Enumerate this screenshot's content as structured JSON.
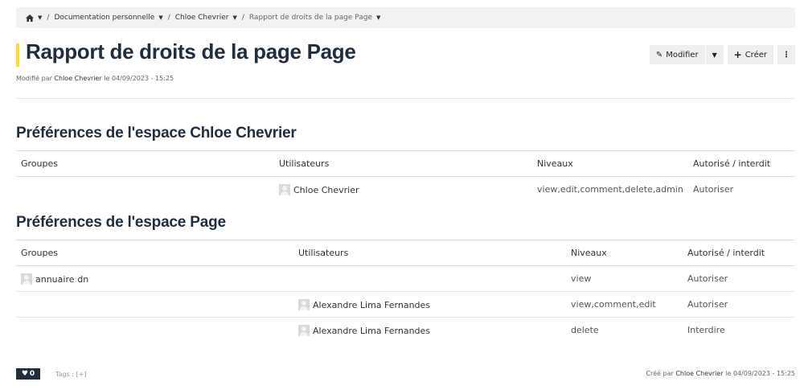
{
  "breadcrumb": {
    "items": [
      "Documentation personnelle",
      "Chloe Chevrier"
    ],
    "current": "Rapport de droits de la page Page"
  },
  "page": {
    "title": "Rapport de droits de la page Page",
    "modified_prefix": "Modifié par",
    "modified_user": "Chloe Chevrier",
    "modified_suffix": "le 04/09/2023 - 15:25"
  },
  "actions": {
    "edit_label": "Modifier",
    "create_label": "Créer"
  },
  "sections": [
    {
      "title": "Préférences de l'espace Chloe Chevrier",
      "columns": [
        "Groupes",
        "Utilisateurs",
        "Niveaux",
        "Autorisé / interdit"
      ],
      "rows": [
        {
          "group": "",
          "user": "Chloe Chevrier",
          "levels": "view,edit,comment,delete,admin",
          "right": "Autoriser"
        }
      ]
    },
    {
      "title": "Préférences de l'espace Page",
      "columns": [
        "Groupes",
        "Utilisateurs",
        "Niveaux",
        "Autorisé / interdit"
      ],
      "rows": [
        {
          "group_name": "annuaire",
          "group_sep": ":",
          "group_suffix": "dn",
          "user": "",
          "levels": "view",
          "right": "Autoriser"
        },
        {
          "group": "",
          "user": "Alexandre Lima Fernandes",
          "levels": "view,comment,edit",
          "right": "Autoriser"
        },
        {
          "group": "",
          "user": "Alexandre Lima Fernandes",
          "levels": "delete",
          "right": "Interdire"
        }
      ]
    }
  ],
  "footer": {
    "likes": "0",
    "tags_label": "Tags :",
    "tags_add": "[+]",
    "created_prefix": "Créé par",
    "created_user": "Chloe Chevrier",
    "created_suffix": "le 04/09/2023 - 15:25"
  },
  "colors": {
    "title_accent": "#f7dc3a",
    "heading": "#1f2d3d",
    "breadcrumb_bg": "#f2f2f2"
  },
  "icons": [
    "home-icon",
    "pencil-icon",
    "plus-icon",
    "heart-icon",
    "kebab-icon"
  ]
}
